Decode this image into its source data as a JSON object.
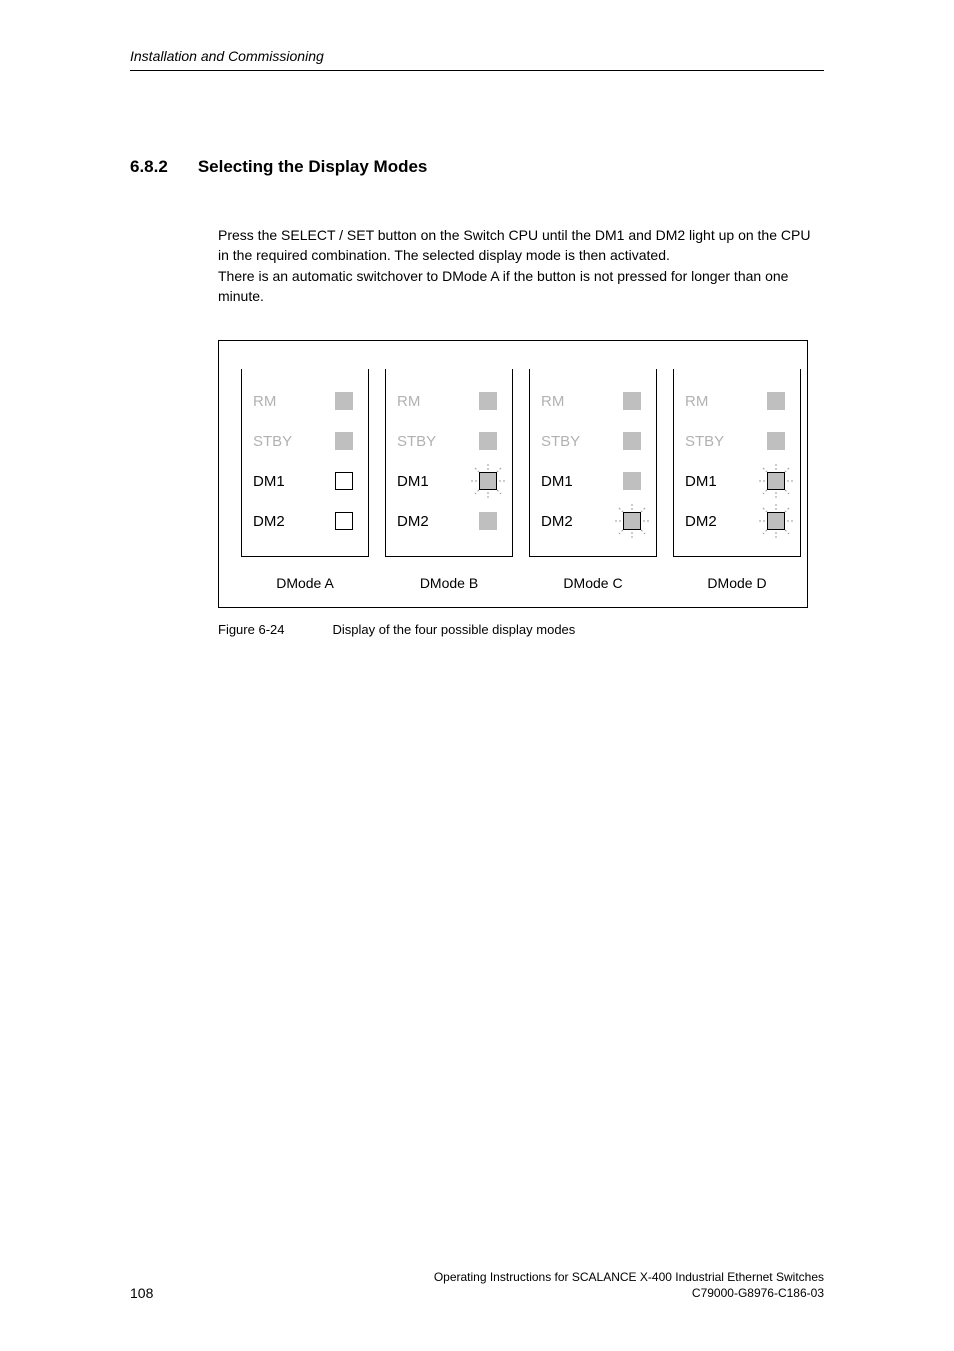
{
  "header": {
    "running_title": "Installation and Commissioning"
  },
  "section": {
    "number": "6.8.2",
    "title": "Selecting the Display Modes"
  },
  "body": {
    "para1": "Press the SELECT / SET button on the Switch CPU until the DM1 and DM2 light up on the CPU in the required combination. The selected display mode is then activated.",
    "para2": "There is an automatic switchover to DMode A if the button is not pressed for longer than one minute."
  },
  "figure": {
    "led_labels": {
      "rm": "RM",
      "stby": "STBY",
      "dm1": "DM1",
      "dm2": "DM2"
    },
    "panels": [
      {
        "mode": "DMode A",
        "dm1_active": false,
        "dm2_active": false
      },
      {
        "mode": "DMode B",
        "dm1_active": true,
        "dm2_active": false
      },
      {
        "mode": "DMode C",
        "dm1_active": false,
        "dm2_active": true
      },
      {
        "mode": "DMode D",
        "dm1_active": true,
        "dm2_active": true
      }
    ],
    "caption_label": "Figure 6-24",
    "caption_text": "Display of the four possible display modes"
  },
  "footer": {
    "page_number": "108",
    "doc_title": "Operating Instructions for SCALANCE X-400 Industrial Ethernet Switches",
    "doc_id": "C79000-G8976-C186-03"
  }
}
